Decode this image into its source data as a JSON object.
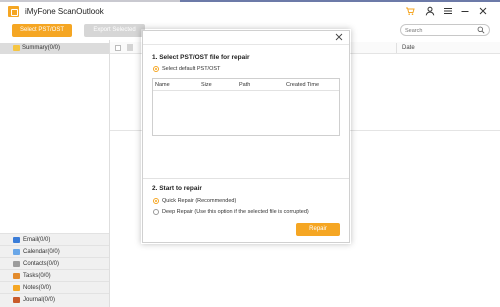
{
  "app": {
    "title": "iMyFone ScanOutlook"
  },
  "toolbar": {
    "select_button": "Select PST/OST",
    "export_button": "Export Selected",
    "search_placeholder": "Search"
  },
  "title_icons": [
    "cart-icon",
    "user-icon",
    "menu-icon",
    "minimize-icon",
    "close-icon"
  ],
  "sidebar": {
    "summary_label": "Summary(0/0)",
    "categories": [
      {
        "label": "Email(0/0)",
        "icon": "email-icon",
        "color": "#3b7dd8"
      },
      {
        "label": "Calendar(0/0)",
        "icon": "calendar-icon",
        "color": "#6aa7e8"
      },
      {
        "label": "Contacts(0/0)",
        "icon": "contacts-icon",
        "color": "#9c9c9c"
      },
      {
        "label": "Tasks(0/0)",
        "icon": "tasks-icon",
        "color": "#e38b2c"
      },
      {
        "label": "Notes(0/0)",
        "icon": "notes-icon",
        "color": "#f5a623"
      },
      {
        "label": "Journal(0/0)",
        "icon": "journal-icon",
        "color": "#c95b2b"
      }
    ]
  },
  "list": {
    "date_header": "Date"
  },
  "dialog": {
    "section1_title": "1. Select PST/OST file for repair",
    "default_option": "Select default PST/OST",
    "table_headers": [
      "Name",
      "Size",
      "Path",
      "Created Time"
    ],
    "section2_title": "2. Start to repair",
    "quick_repair": "Quick Repair (Recommended)",
    "deep_repair": "Deep Repair (Use this option if the selected file is corrupted)",
    "repair_button": "Repair"
  },
  "colors": {
    "accent": "#f5a623",
    "disabled": "#d6d6d6"
  }
}
